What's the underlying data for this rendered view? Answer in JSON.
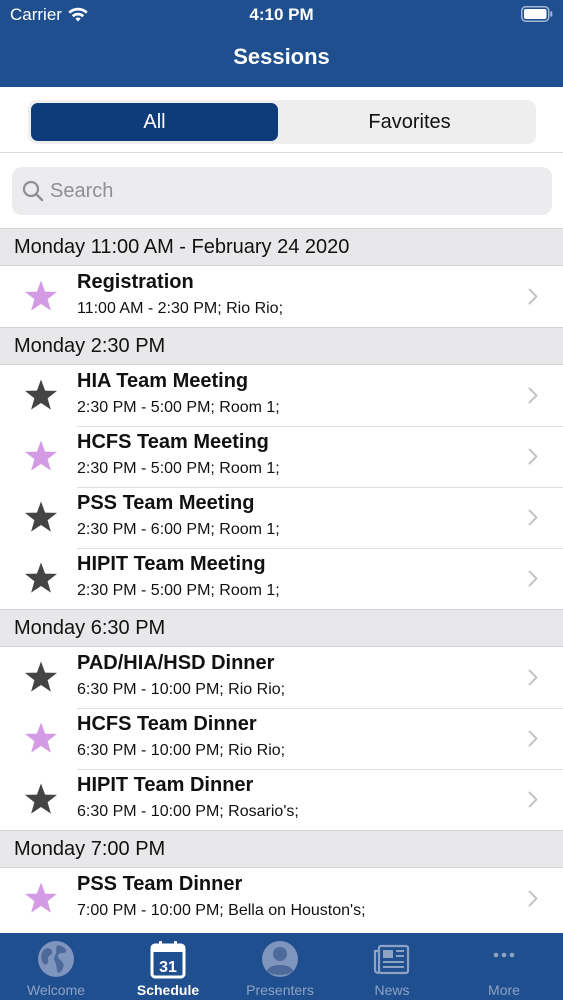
{
  "status": {
    "carrier": "Carrier",
    "time": "4:10 PM"
  },
  "nav": {
    "title": "Sessions"
  },
  "segments": {
    "all": "All",
    "favorites": "Favorites",
    "selected": "All"
  },
  "search": {
    "placeholder": "Search",
    "value": ""
  },
  "colors": {
    "brand": "#1f4f8f",
    "segment_active": "#0e3b7a",
    "favorite_star": "#d39be4",
    "regular_star": "#444444"
  },
  "sections": [
    {
      "header": "Monday 11:00 AM - February 24 2020",
      "rows": [
        {
          "title": "Registration",
          "subtitle": "11:00 AM - 2:30 PM; Rio Rio;",
          "favorite": true
        }
      ]
    },
    {
      "header": "Monday 2:30 PM",
      "rows": [
        {
          "title": "HIA Team Meeting",
          "subtitle": "2:30 PM - 5:00 PM; Room 1;",
          "favorite": false
        },
        {
          "title": "HCFS Team Meeting",
          "subtitle": "2:30 PM - 5:00 PM; Room 1;",
          "favorite": true
        },
        {
          "title": "PSS Team Meeting",
          "subtitle": "2:30 PM - 6:00 PM; Room 1;",
          "favorite": false
        },
        {
          "title": "HIPIT Team Meeting",
          "subtitle": "2:30 PM - 5:00 PM; Room 1;",
          "favorite": false
        }
      ]
    },
    {
      "header": "Monday 6:30 PM",
      "rows": [
        {
          "title": "PAD/HIA/HSD Dinner",
          "subtitle": "6:30 PM - 10:00 PM; Rio Rio;",
          "favorite": false
        },
        {
          "title": "HCFS Team Dinner",
          "subtitle": "6:30 PM - 10:00 PM; Rio Rio;",
          "favorite": true
        },
        {
          "title": "HIPIT Team Dinner",
          "subtitle": "6:30 PM - 10:00 PM; Rosario's;",
          "favorite": false
        }
      ]
    },
    {
      "header": "Monday 7:00 PM",
      "rows": [
        {
          "title": "PSS Team Dinner",
          "subtitle": "7:00 PM - 10:00 PM; Bella on Houston's;",
          "favorite": true
        }
      ]
    }
  ],
  "tabs": [
    {
      "label": "Welcome",
      "icon": "globe-icon",
      "active": false
    },
    {
      "label": "Schedule",
      "icon": "calendar-icon",
      "calendar_day": "31",
      "active": true
    },
    {
      "label": "Presenters",
      "icon": "person-icon",
      "active": false
    },
    {
      "label": "News",
      "icon": "newspaper-icon",
      "active": false
    },
    {
      "label": "More",
      "icon": "more-icon",
      "active": false
    }
  ]
}
